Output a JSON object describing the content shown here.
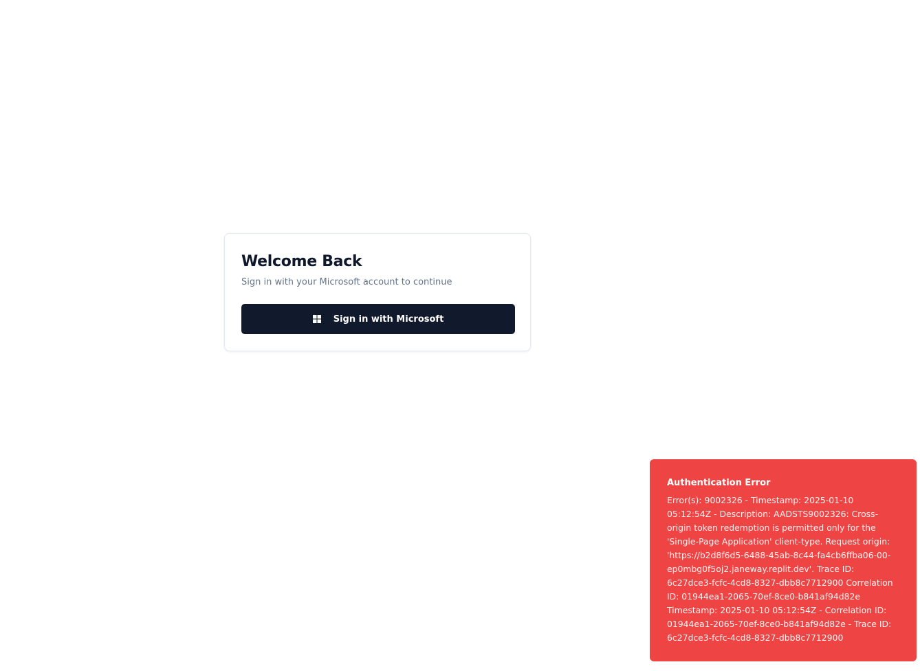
{
  "login_card": {
    "title": "Welcome Back",
    "subtitle": "Sign in with your Microsoft account to continue",
    "signin_button": {
      "label": "Sign in with Microsoft",
      "icon": "windows-logo-icon"
    }
  },
  "error_toast": {
    "title": "Authentication Error",
    "message": "Error(s): 9002326 - Timestamp: 2025-01-10 05:12:54Z - Description: AADSTS9002326: Cross-origin token redemption is permitted only for the 'Single-Page Application' client-type. Request origin: 'https://b2d8f6d5-6488-45ab-8c44-fa4cb6ffba06-00-ep0mbg0f5oj2.janeway.replit.dev'. Trace ID: 6c27dce3-fcfc-4cd8-8327-dbb8c7712900 Correlation ID: 01944ea1-2065-70ef-8ce0-b841af94d82e Timestamp: 2025-01-10 05:12:54Z - Correlation ID: 01944ea1-2065-70ef-8ce0-b841af94d82e - Trace ID: 6c27dce3-fcfc-4cd8-8327-dbb8c7712900"
  },
  "colors": {
    "button_background": "#111a2c",
    "toast_background": "#ef4444",
    "subtitle_text": "#64748b"
  }
}
